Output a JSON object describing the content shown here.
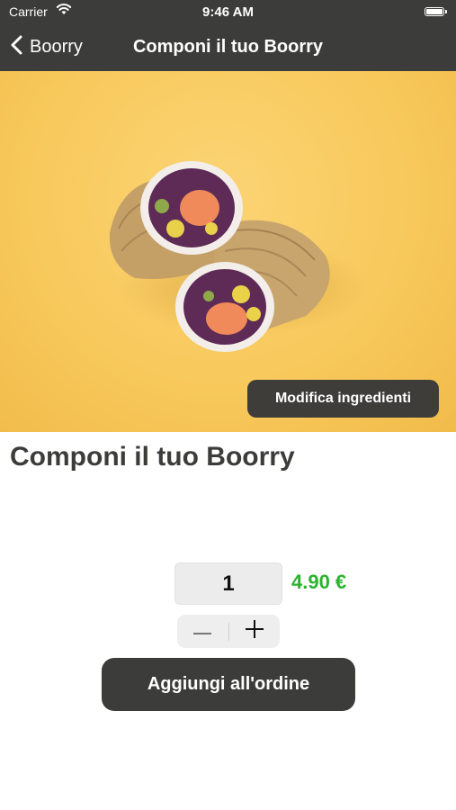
{
  "status_bar": {
    "carrier": "Carrier",
    "time": "9:46 AM",
    "battery_level": 1.0
  },
  "nav": {
    "back_label": "Boorry",
    "title": "Componi il tuo Boorry"
  },
  "hero": {
    "edit_button_label": "Modifica ingredienti"
  },
  "product": {
    "title": "Componi il tuo Boorry",
    "quantity": "1",
    "price": "4.90 €"
  },
  "actions": {
    "add_to_order_label": "Aggiungi all'ordine"
  },
  "colors": {
    "bar_bg": "#3c3c3b",
    "hero_bg": "#f8c95c",
    "price_green": "#2bb32f",
    "button_dark": "#3c3c3b"
  }
}
